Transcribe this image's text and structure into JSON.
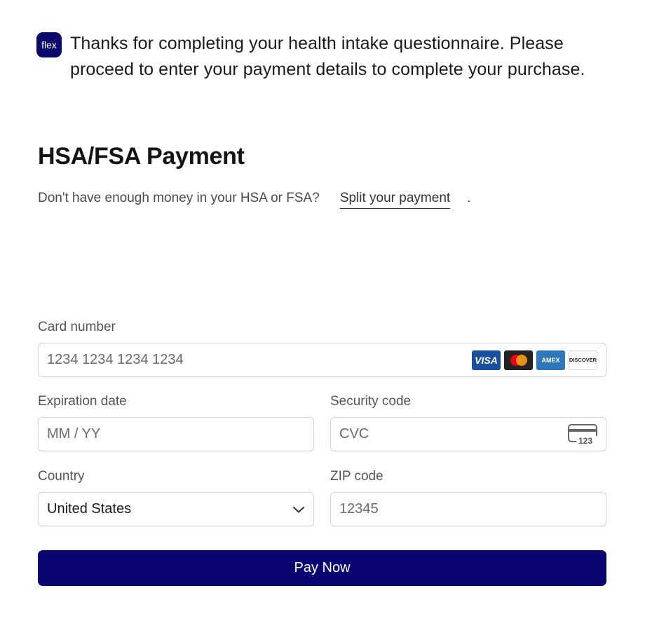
{
  "banner": {
    "logo_text": "flex",
    "message": "Thanks for completing your health intake questionnaire. Please proceed to enter your payment details to complete your purchase."
  },
  "payment": {
    "title": "HSA/FSA Payment",
    "subline_text": "Don't have enough money in your HSA or FSA?",
    "split_link": "Split your payment",
    "period": "."
  },
  "form": {
    "card_number": {
      "label": "Card number",
      "placeholder": "1234 1234 1234 1234"
    },
    "card_brands": [
      {
        "name": "visa-icon",
        "text": "VISA",
        "color": "#1a4fa0"
      },
      {
        "name": "mastercard-icon",
        "text": "",
        "color": "#222222"
      },
      {
        "name": "amex-icon",
        "text": "AMEX",
        "color": "#2e77bb"
      },
      {
        "name": "discover-icon",
        "text": "DISCOVER",
        "color": "#ffffff"
      }
    ],
    "expiration": {
      "label": "Expiration date",
      "placeholder": "MM / YY"
    },
    "security": {
      "label": "Security code",
      "placeholder": "CVC",
      "icon_text": "123"
    },
    "country": {
      "label": "Country",
      "value": "United States"
    },
    "zip": {
      "label": "ZIP code",
      "placeholder": "12345"
    }
  },
  "pay_button": {
    "label": "Pay Now",
    "color": "#0a0470"
  }
}
